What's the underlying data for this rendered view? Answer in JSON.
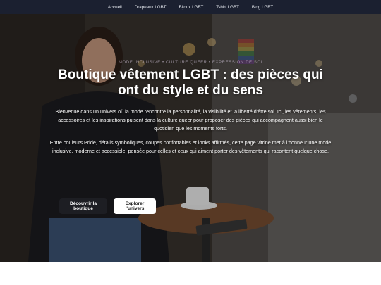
{
  "nav": {
    "items": [
      {
        "label": "Accueil"
      },
      {
        "label": "Drapeaux LGBT"
      },
      {
        "label": "Bijoux LGBT"
      },
      {
        "label": "Tshirt LGBT"
      },
      {
        "label": "Blog LGBT"
      }
    ],
    "background": "#1b2030"
  },
  "hero": {
    "kicker": "MODE INCLUSIVE • CULTURE QUEER • EXPRESSION DE SOI",
    "title": "Boutique vêtement LGBT : des pièces qui ont du style et du sens",
    "paragraph_1": "Bienvenue dans un univers où la mode rencontre la personnalité, la visibilité et la liberté d’être soi. Ici, les vêtements, les accessoires et les inspirations puisent dans la culture queer pour proposer des pièces qui accompagnent aussi bien le quotidien que les moments forts.",
    "paragraph_2": "Entre couleurs Pride, détails symboliques, coupes confortables et looks affirmés, cette page vitrine met à l’honneur une mode inclusive, moderne et accessible, pensée pour celles et ceux qui aiment porter des vêtements qui racontent quelque chose.",
    "primary_button": "Découvrir la boutique",
    "secondary_button": "Explorer l'univers"
  },
  "colors": {
    "button_dark": "#1d1e23",
    "button_light": "#ffffff",
    "text": "#ffffff"
  }
}
